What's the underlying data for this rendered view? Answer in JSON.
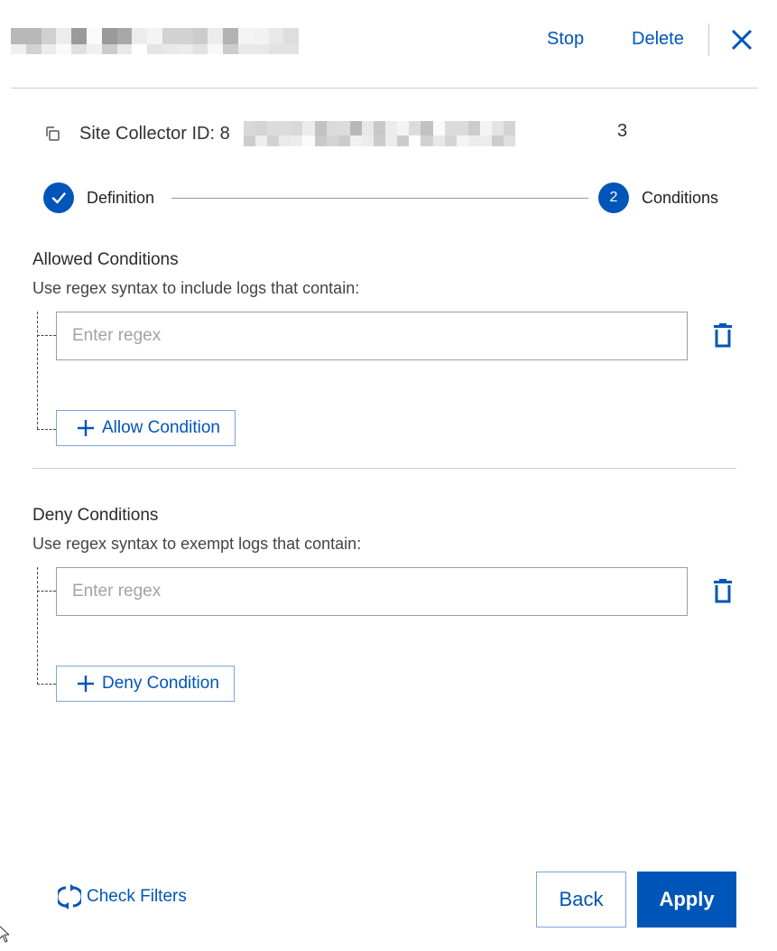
{
  "header": {
    "title_redacted": true,
    "stop_label": "Stop",
    "delete_label": "Delete",
    "close_icon": "close-icon"
  },
  "site_collector": {
    "label": "Site Collector ID: ",
    "id_prefix": "8",
    "id_suffix": "3",
    "id_redacted": true,
    "copy_icon": "copy-icon"
  },
  "stepper": {
    "steps": [
      {
        "label": "Definition",
        "state": "completed",
        "icon": "check-icon"
      },
      {
        "label": "Conditions",
        "state": "active",
        "number": "2"
      }
    ]
  },
  "allowed": {
    "title": "Allowed Conditions",
    "description": "Use regex syntax to include logs that contain:",
    "input_value": "",
    "input_placeholder": "Enter regex",
    "add_button_label": "Allow Condition"
  },
  "deny": {
    "title": "Deny Conditions",
    "description": "Use regex syntax to exempt logs that contain:",
    "input_value": "",
    "input_placeholder": "Enter regex",
    "add_button_label": "Deny Condition"
  },
  "footer": {
    "check_filters_label": "Check Filters",
    "back_label": "Back",
    "apply_label": "Apply"
  },
  "colors": {
    "accent": "#0055b8",
    "border": "#9e9e9e",
    "divider": "#cfcfcf",
    "secondary_border": "#7aa6dc"
  }
}
